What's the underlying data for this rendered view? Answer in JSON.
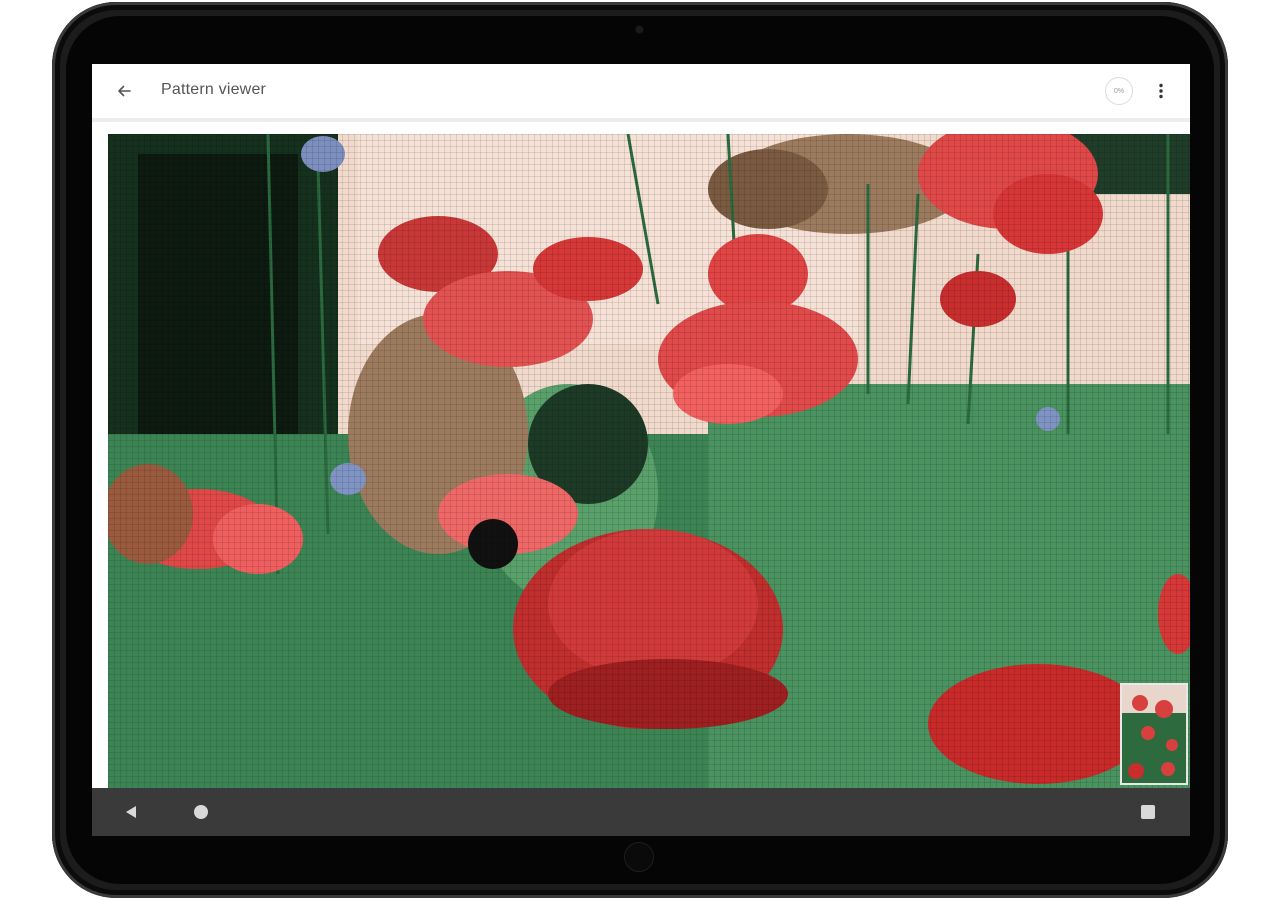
{
  "app": {
    "title": "Pattern viewer",
    "progress_label": "0%"
  },
  "icons": {
    "back": "arrow-left-icon",
    "more": "more-vert-icon",
    "nav_back": "triangle-back-icon",
    "nav_home": "circle-home-icon",
    "nav_recents": "square-recents-icon"
  },
  "colors": {
    "app_bar": "#ffffff",
    "title_text": "#555555",
    "nav_bar": "#3a3a3a",
    "poppy_red": "#d93a3a",
    "foliage_green": "#2f6e45"
  }
}
